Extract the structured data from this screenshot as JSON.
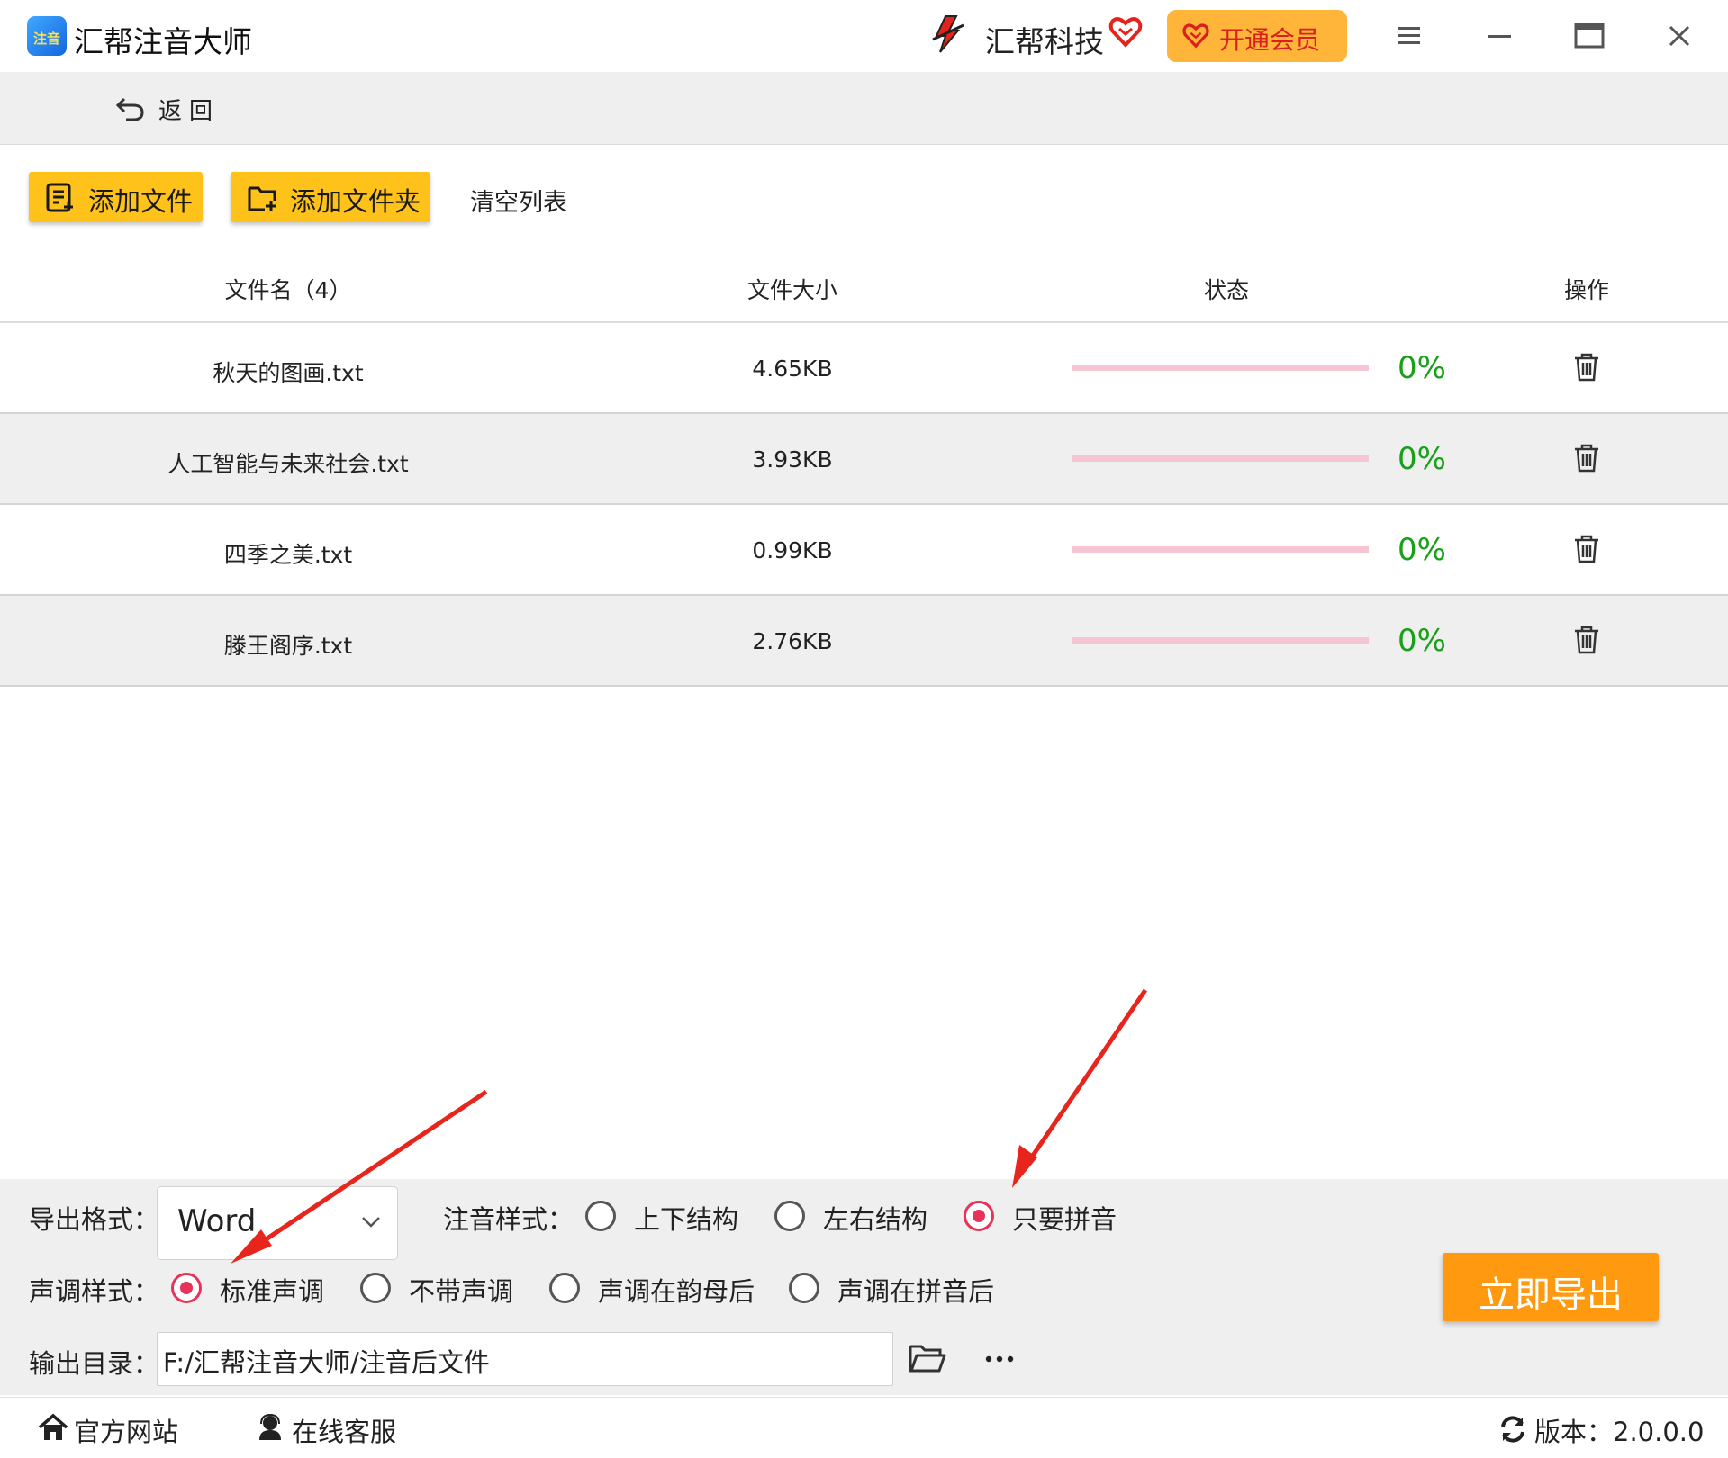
{
  "window": {
    "app_title": "汇帮注音大师",
    "app_logo_text": "注音",
    "brand_name": "汇帮科技",
    "vip_label": "开通会员"
  },
  "nav": {
    "back_label": "返回"
  },
  "toolbar": {
    "add_file_label": "添加文件",
    "add_folder_label": "添加文件夹",
    "clear_list_label": "清空列表"
  },
  "table": {
    "headers": {
      "name": "文件名（4）",
      "size": "文件大小",
      "status": "状态",
      "action": "操作"
    },
    "rows": [
      {
        "name": "秋天的图画.txt",
        "size": "4.65KB",
        "progress": 0,
        "progress_text": "0%"
      },
      {
        "name": "人工智能与未来社会.txt",
        "size": "3.93KB",
        "progress": 0,
        "progress_text": "0%"
      },
      {
        "name": "四季之美.txt",
        "size": "0.99KB",
        "progress": 0,
        "progress_text": "0%"
      },
      {
        "name": "滕王阁序.txt",
        "size": "2.76KB",
        "progress": 0,
        "progress_text": "0%"
      }
    ]
  },
  "settings": {
    "export_format_label": "导出格式：",
    "export_format_value": "Word",
    "pinyin_style_label": "注音样式：",
    "pinyin_style_options": [
      {
        "label": "上下结构",
        "selected": false
      },
      {
        "label": "左右结构",
        "selected": false
      },
      {
        "label": "只要拼音",
        "selected": true
      }
    ],
    "tone_style_label": "声调样式：",
    "tone_style_options": [
      {
        "label": "标准声调",
        "selected": true
      },
      {
        "label": "不带声调",
        "selected": false
      },
      {
        "label": "声调在韵母后",
        "selected": false
      },
      {
        "label": "声调在拼音后",
        "selected": false
      }
    ],
    "output_dir_label": "输出目录：",
    "output_dir_value": "F:/汇帮注音大师/注音后文件",
    "export_button_label": "立即导出"
  },
  "footer": {
    "website_label": "官方网站",
    "service_label": "在线客服",
    "version_label": "版本：2.0.0.0"
  },
  "colors": {
    "accent_yellow": "#ffc21a",
    "export_orange": "#ff9a10",
    "vip_orange": "#ffb43a",
    "radio_selected": "#e8325a",
    "progress_track": "#f5c6d2",
    "percent_green": "#18a018",
    "annotation_arrow": "#e8251c"
  },
  "icons": [
    "app-logo-icon",
    "brand-logo-icon",
    "brand-heart-icon",
    "menu-icon",
    "minimize-icon",
    "maximize-icon",
    "close-icon",
    "back-arrow-icon",
    "add-file-icon",
    "add-folder-icon",
    "trash-icon",
    "chevron-down-icon",
    "folder-open-icon",
    "more-icon",
    "home-icon",
    "support-icon",
    "refresh-icon"
  ]
}
